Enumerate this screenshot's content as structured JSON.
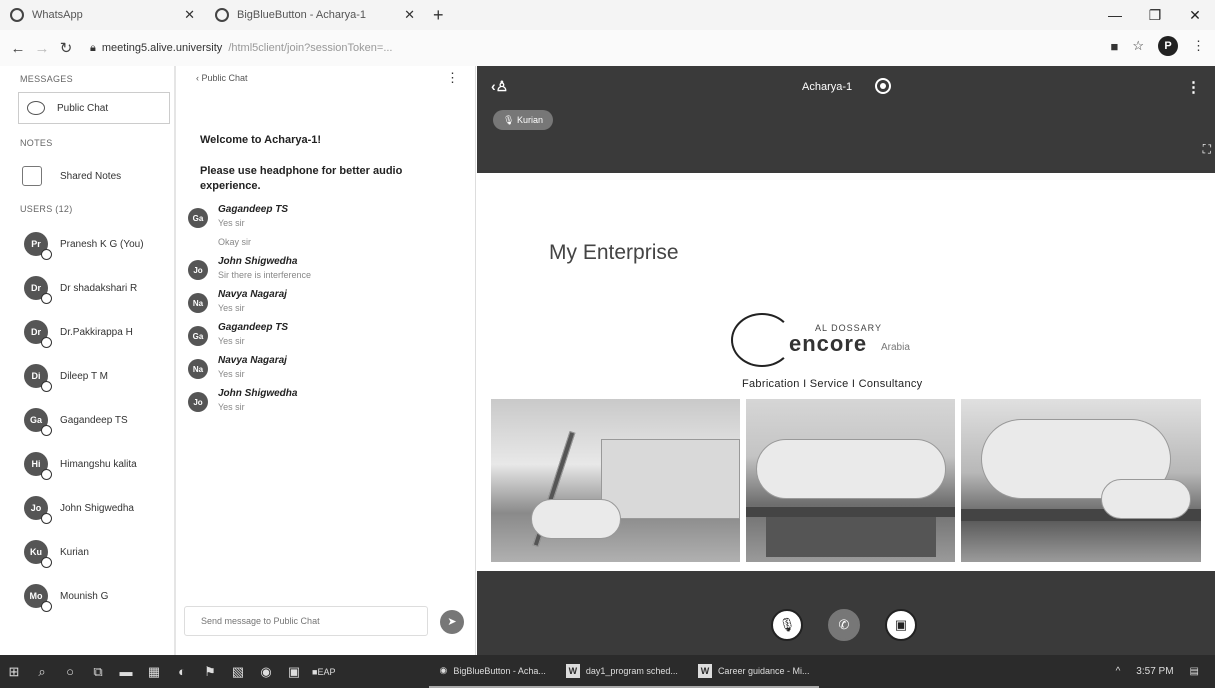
{
  "browser": {
    "tabs": [
      {
        "label": "WhatsApp"
      },
      {
        "label": "BigBlueButton - Acharya-1"
      }
    ],
    "new_tab": "+",
    "url_host": "meeting5.alive.university",
    "url_rest": "/html5client/join?sessionToken=...",
    "profile_initial": "P"
  },
  "sidebar": {
    "messages_heading": "MESSAGES",
    "public_chat_label": "Public Chat",
    "notes_heading": "NOTES",
    "shared_notes_label": "Shared Notes",
    "users_heading": "USERS (12)",
    "users": [
      {
        "initials": "Pr",
        "name": "Pranesh K G (You)"
      },
      {
        "initials": "Dr",
        "name": "Dr shadakshari R"
      },
      {
        "initials": "Dr",
        "name": "Dr.Pakkirappa H"
      },
      {
        "initials": "Di",
        "name": "Dileep T M"
      },
      {
        "initials": "Ga",
        "name": "Gagandeep TS"
      },
      {
        "initials": "Hi",
        "name": "Himangshu kalita"
      },
      {
        "initials": "Jo",
        "name": "John Shigwedha"
      },
      {
        "initials": "Ku",
        "name": "Kurian"
      },
      {
        "initials": "Mo",
        "name": "Mounish G"
      }
    ]
  },
  "chat": {
    "back_label": "‹ Public Chat",
    "welcome": "Welcome to Acharya-1!",
    "notice": "Please use headphone for better audio experience.",
    "messages": [
      {
        "initials": "Ga",
        "name": "Gagandeep TS",
        "text": "Yes sir",
        "text2": "Okay sir"
      },
      {
        "initials": "Jo",
        "name": "John Shigwedha",
        "text": "Sir there is interference"
      },
      {
        "initials": "Na",
        "name": "Navya Nagaraj",
        "text": "Yes sir"
      },
      {
        "initials": "Ga",
        "name": "Gagandeep TS",
        "text": "Yes sir"
      },
      {
        "initials": "Na",
        "name": "Navya Nagaraj",
        "text": "Yes sir"
      },
      {
        "initials": "Jo",
        "name": "John Shigwedha",
        "text": "Yes sir"
      }
    ],
    "input_placeholder": "Send message to Public Chat"
  },
  "stage": {
    "meeting_title": "Acharya-1",
    "talking_user": "Kurian",
    "slide_title": "My Enterprise",
    "logo_small": "AL DOSSARY",
    "logo_main": "encore",
    "logo_sub": "Arabia",
    "tagline": "Fabrication  I  Service  I  Consultancy"
  },
  "taskbar": {
    "pinned_label": "EAP",
    "apps": [
      {
        "label": "BigBlueButton - Acha..."
      },
      {
        "label": "day1_program sched..."
      },
      {
        "label": "Career guidance - Mi..."
      }
    ],
    "time": "3:57 PM"
  }
}
